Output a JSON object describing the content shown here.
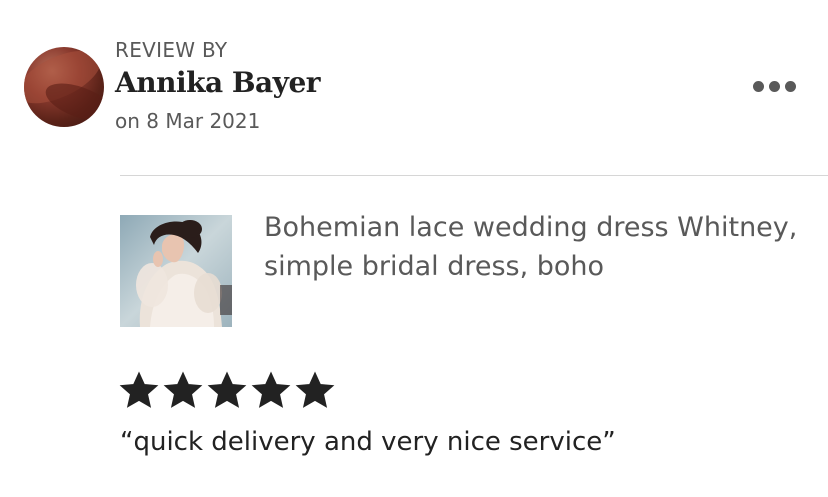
{
  "review": {
    "header_label": "REVIEW BY",
    "reviewer_name": "Annika Bayer",
    "date": "on 8 Mar 2021",
    "more_icon": "more-horizontal-icon",
    "rating": 5,
    "rating_max": 5,
    "text": "“quick delivery and very nice service”"
  },
  "listing": {
    "title": "Bohemian lace wedding dress Whitney, simple bridal dress, boho"
  },
  "colors": {
    "primary_text": "#222222",
    "secondary_text": "#595959",
    "divider": "#d6d6d6",
    "star": "#222222"
  }
}
